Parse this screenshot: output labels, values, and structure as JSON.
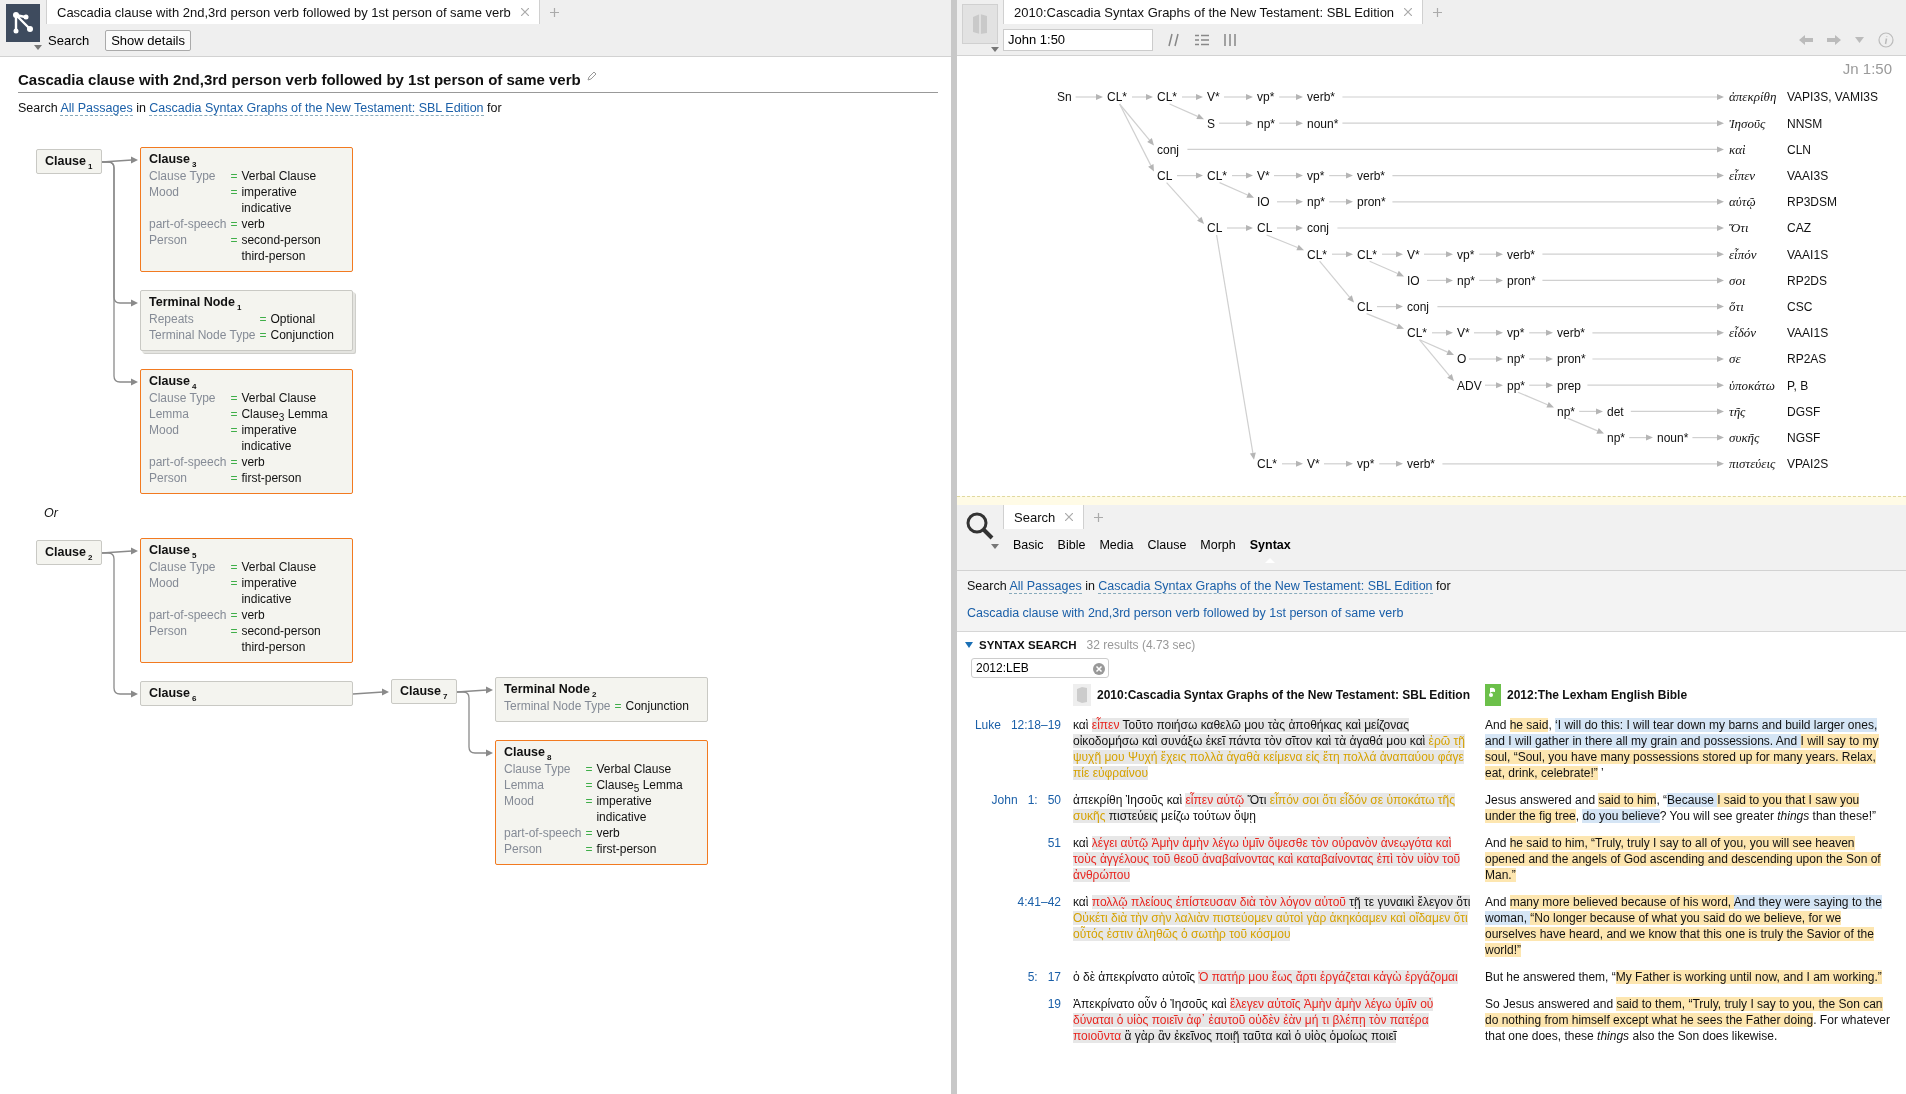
{
  "left_panel": {
    "tab": {
      "title": "Cascadia clause with 2nd,3rd person verb followed by 1st person of same verb"
    },
    "toolbar": {
      "search_label": "Search",
      "details_button": "Show details"
    },
    "heading": "Cascadia clause with 2nd,3rd person verb followed by 1st person of same verb",
    "search_line": {
      "prefix": "Search",
      "range": "All Passages",
      "joiner": "in",
      "resource": "Cascadia Syntax Graphs of the New Testament: SBL Edition",
      "suffix": "for"
    },
    "query": {
      "separator": "Or",
      "alternatives": [
        {
          "title": "Clause",
          "index": "1",
          "highlighted": false,
          "stacked": false,
          "children": [
            {
              "title": "Clause",
              "index": "3",
              "highlighted": true,
              "stacked": false,
              "attributes": [
                {
                  "name": "Clause Type",
                  "operator": "=",
                  "values": [
                    "Verbal Clause"
                  ]
                },
                {
                  "name": "Mood",
                  "operator": "=",
                  "values": [
                    "imperative",
                    "indicative"
                  ]
                },
                {
                  "name": "part-of-speech",
                  "operator": "=",
                  "values": [
                    "verb"
                  ]
                },
                {
                  "name": "Person",
                  "operator": "=",
                  "values": [
                    "second-person",
                    "third-person"
                  ]
                }
              ]
            },
            {
              "title": "Terminal Node",
              "index": "1",
              "highlighted": false,
              "stacked": true,
              "attributes": [
                {
                  "name": "Repeats",
                  "operator": "=",
                  "values": [
                    "Optional"
                  ]
                },
                {
                  "name": "Terminal Node Type",
                  "operator": "=",
                  "values": [
                    "Conjunction"
                  ]
                }
              ]
            },
            {
              "title": "Clause",
              "index": "4",
              "highlighted": true,
              "stacked": false,
              "attributes": [
                {
                  "name": "Clause Type",
                  "operator": "=",
                  "values": [
                    "Verbal Clause"
                  ]
                },
                {
                  "name": "Lemma",
                  "operator": "=",
                  "values": [
                    "Clause$_{3}$ Lemma"
                  ]
                },
                {
                  "name": "Mood",
                  "operator": "=",
                  "values": [
                    "imperative",
                    "indicative"
                  ]
                },
                {
                  "name": "part-of-speech",
                  "operator": "=",
                  "values": [
                    "verb"
                  ]
                },
                {
                  "name": "Person",
                  "operator": "=",
                  "values": [
                    "first-person"
                  ]
                }
              ]
            }
          ]
        },
        {
          "title": "Clause",
          "index": "2",
          "highlighted": false,
          "stacked": false,
          "children": [
            {
              "title": "Clause",
              "index": "5",
              "highlighted": true,
              "stacked": false,
              "attributes": [
                {
                  "name": "Clause Type",
                  "operator": "=",
                  "values": [
                    "Verbal Clause"
                  ]
                },
                {
                  "name": "Mood",
                  "operator": "=",
                  "values": [
                    "imperative",
                    "indicative"
                  ]
                },
                {
                  "name": "part-of-speech",
                  "operator": "=",
                  "values": [
                    "verb"
                  ]
                },
                {
                  "name": "Person",
                  "operator": "=",
                  "values": [
                    "second-person",
                    "third-person"
                  ]
                }
              ]
            },
            {
              "title": "Clause",
              "index": "6",
              "highlighted": false,
              "stacked": false,
              "children": [
                {
                  "title": "Clause",
                  "index": "7",
                  "highlighted": false,
                  "stacked": false,
                  "children": [
                    {
                      "title": "Terminal Node",
                      "index": "2",
                      "highlighted": false,
                      "stacked": false,
                      "attributes": [
                        {
                          "name": "Terminal Node Type",
                          "operator": "=",
                          "values": [
                            "Conjunction"
                          ]
                        }
                      ]
                    },
                    {
                      "title": "Clause",
                      "index": "8",
                      "highlighted": true,
                      "stacked": false,
                      "attributes": [
                        {
                          "name": "Clause Type",
                          "operator": "=",
                          "values": [
                            "Verbal Clause"
                          ]
                        },
                        {
                          "name": "Lemma",
                          "operator": "=",
                          "values": [
                            "Clause$_{5}$ Lemma"
                          ]
                        },
                        {
                          "name": "Mood",
                          "operator": "=",
                          "values": [
                            "imperative",
                            "indicative"
                          ]
                        },
                        {
                          "name": "part-of-speech",
                          "operator": "=",
                          "values": [
                            "verb"
                          ]
                        },
                        {
                          "name": "Person",
                          "operator": "=",
                          "values": [
                            "first-person"
                          ]
                        }
                      ]
                    }
                  ]
                }
              ]
            }
          ]
        }
      ]
    }
  },
  "reader_panel": {
    "tab": {
      "title": "2010:Cascadia Syntax Graphs of the New Testament: SBL Edition"
    },
    "reference_field": {
      "value": "John 1:50"
    },
    "location_label": "Jn 1:50",
    "syntax_tree": {
      "label": "Sn",
      "children": [
        {
          "label": "CL*",
          "children": [
            {
              "label": "CL*",
              "children": [
                {
                  "label": "V*",
                  "children": [
                    {
                      "label": "vp*",
                      "children": [
                        {
                          "label": "verb*",
                          "word": "ἀπεκρίθη",
                          "parse": "VAPI3S, VAMI3S"
                        }
                      ]
                    }
                  ]
                },
                {
                  "label": "S",
                  "children": [
                    {
                      "label": "np*",
                      "children": [
                        {
                          "label": "noun*",
                          "word": "Ἰησοῦς",
                          "parse": "NNSM"
                        }
                      ]
                    }
                  ]
                }
              ]
            },
            {
              "label": "conj",
              "word": "καὶ",
              "parse": "CLN"
            },
            {
              "label": "CL",
              "children": [
                {
                  "label": "CL*",
                  "children": [
                    {
                      "label": "V*",
                      "children": [
                        {
                          "label": "vp*",
                          "children": [
                            {
                              "label": "verb*",
                              "word": "εἶπεν",
                              "parse": "VAAI3S"
                            }
                          ]
                        }
                      ]
                    },
                    {
                      "label": "IO",
                      "children": [
                        {
                          "label": "np*",
                          "children": [
                            {
                              "label": "pron*",
                              "word": "αὐτῷ",
                              "parse": "RP3DSM"
                            }
                          ]
                        }
                      ]
                    }
                  ]
                },
                {
                  "label": "CL",
                  "children": [
                    {
                      "label": "CL",
                      "children": [
                        {
                          "label": "conj",
                          "word": "Ὅτι",
                          "parse": "CAZ"
                        },
                        {
                          "label": "CL*",
                          "children": [
                            {
                              "label": "CL*",
                              "children": [
                                {
                                  "label": "V*",
                                  "children": [
                                    {
                                      "label": "vp*",
                                      "children": [
                                        {
                                          "label": "verb*",
                                          "word": "εἶπόν",
                                          "parse": "VAAI1S"
                                        }
                                      ]
                                    }
                                  ]
                                },
                                {
                                  "label": "IO",
                                  "children": [
                                    {
                                      "label": "np*",
                                      "children": [
                                        {
                                          "label": "pron*",
                                          "word": "σοι",
                                          "parse": "RP2DS"
                                        }
                                      ]
                                    }
                                  ]
                                }
                              ]
                            },
                            {
                              "label": "CL",
                              "children": [
                                {
                                  "label": "conj",
                                  "word": "ὅτι",
                                  "parse": "CSC"
                                },
                                {
                                  "label": "CL*",
                                  "children": [
                                    {
                                      "label": "V*",
                                      "children": [
                                        {
                                          "label": "vp*",
                                          "children": [
                                            {
                                              "label": "verb*",
                                              "word": "εἶδόν",
                                              "parse": "VAAI1S"
                                            }
                                          ]
                                        }
                                      ]
                                    },
                                    {
                                      "label": "O",
                                      "children": [
                                        {
                                          "label": "np*",
                                          "children": [
                                            {
                                              "label": "pron*",
                                              "word": "σε",
                                              "parse": "RP2AS"
                                            }
                                          ]
                                        }
                                      ]
                                    },
                                    {
                                      "label": "ADV",
                                      "children": [
                                        {
                                          "label": "pp*",
                                          "children": [
                                            {
                                              "label": "prep",
                                              "word": "ὑποκάτω",
                                              "parse": "P, B"
                                            },
                                            {
                                              "label": "np*",
                                              "children": [
                                                {
                                                  "label": "det",
                                                  "word": "τῆς",
                                                  "parse": "DGSF"
                                                },
                                                {
                                                  "label": "np*",
                                                  "children": [
                                                    {
                                                      "label": "noun*",
                                                      "word": "συκῆς",
                                                      "parse": "NGSF"
                                                    }
                                                  ]
                                                }
                                              ]
                                            }
                                          ]
                                        }
                                      ]
                                    }
                                  ]
                                }
                              ]
                            }
                          ]
                        }
                      ]
                    },
                    {
                      "label": "CL*",
                      "children": [
                        {
                          "label": "V*",
                          "children": [
                            {
                              "label": "vp*",
                              "children": [
                                {
                                  "label": "verb*",
                                  "word": "πιστεύεις",
                                  "parse": "VPAI2S"
                                }
                              ]
                            }
                          ]
                        }
                      ]
                    }
                  ]
                }
              ]
            }
          ]
        }
      ]
    }
  },
  "search_panel": {
    "tab": {
      "title": "Search"
    },
    "search_types": [
      {
        "label": "Basic",
        "selected": false
      },
      {
        "label": "Bible",
        "selected": false
      },
      {
        "label": "Media",
        "selected": false
      },
      {
        "label": "Clause",
        "selected": false
      },
      {
        "label": "Morph",
        "selected": false
      },
      {
        "label": "Syntax",
        "selected": true
      }
    ],
    "search_line": {
      "prefix": "Search",
      "range": "All Passages",
      "joiner": "in",
      "resource": "Cascadia Syntax Graphs of the New Testament: SBL Edition",
      "suffix": "for"
    },
    "query_link": "Cascadia clause with 2nd,3rd person verb followed by 1st person of same verb",
    "section": {
      "title": "SYNTAX SEARCH",
      "summary": "32 results (4.73 sec)",
      "expanded": true
    },
    "filter_field": {
      "value": "2012:LEB"
    },
    "columns": [
      {
        "title": "2010:Cascadia Syntax Graphs of the New Testament: SBL Edition",
        "kind": "cascadia"
      },
      {
        "title": "2012:The Lexham English Bible",
        "kind": "leb"
      }
    ],
    "results": [
      {
        "reference": [
          "Luke",
          "12:18–19"
        ],
        "greek": [
          {
            "kind": "plain",
            "text": "καὶ "
          },
          {
            "kind": "primary",
            "text": "εἶπεν"
          },
          {
            "kind": "context",
            "text": " Τοῦτο ποιήσω καθελῶ μου τὰς ἀποθήκας καὶ μείζονας οἰκοδομήσω καὶ συνάξω ἐκεῖ πάντα τὸν σῖτον καὶ τὰ ἀγαθά μου καὶ "
          },
          {
            "kind": "secondary",
            "text": "ἐρῶ τῇ ψυχῇ μου Ψυχή ἔχεις πολλὰ ἀγαθὰ κείμενα εἰς ἔτη πολλά ἀναπαύου φάγε πίε εὐφραίνου"
          }
        ],
        "english": [
          {
            "kind": "plain",
            "text": "And "
          },
          {
            "kind": "primary",
            "text": "he said"
          },
          {
            "kind": "plain",
            "text": ", "
          },
          {
            "kind": "secondary",
            "text": "‘I will do this: I will tear down my barns and build larger ones, and I will gather in there all my grain and possessions. And "
          },
          {
            "kind": "primary",
            "text": "I will say to my soul, “Soul, you have many possessions stored up for many years. Relax, eat, drink, celebrate!”"
          },
          {
            "kind": "plain",
            "text": " ’"
          }
        ]
      },
      {
        "reference": [
          "John",
          "1:",
          "50"
        ],
        "greek": [
          {
            "kind": "plain",
            "text": "ἀπεκρίθη Ἰησοῦς καὶ "
          },
          {
            "kind": "primary",
            "text": "εἶπεν αὐτῷ"
          },
          {
            "kind": "context",
            "text": " Ὅτι "
          },
          {
            "kind": "secondary",
            "text": "εἶπόν σοι ὅτι εἶδόν σε ὑποκάτω τῆς συκῆς"
          },
          {
            "kind": "context",
            "text": " πιστεύεις"
          },
          {
            "kind": "plain",
            "text": " μείζω τούτων ὄψῃ"
          }
        ],
        "english": [
          {
            "kind": "plain",
            "text": "Jesus answered and "
          },
          {
            "kind": "primary",
            "text": "said to him"
          },
          {
            "kind": "plain",
            "text": ", “"
          },
          {
            "kind": "secondary",
            "text": "Because "
          },
          {
            "kind": "primary",
            "text": "I said to you that I saw you under the fig tree"
          },
          {
            "kind": "plain",
            "text": ", "
          },
          {
            "kind": "secondary",
            "text": "do you believe"
          },
          {
            "kind": "plain",
            "text": "? You will see greater *things* than these!”"
          }
        ]
      },
      {
        "reference": [
          "51"
        ],
        "greek": [
          {
            "kind": "plain",
            "text": "καὶ "
          },
          {
            "kind": "primary",
            "text": "λέγει αὐτῷ Ἀμὴν ἀμὴν λέγω ὑμῖν ὄψεσθε τὸν οὐρανὸν ἀνεῳγότα καὶ τοὺς ἀγγέλους τοῦ θεοῦ ἀναβαίνοντας καὶ καταβαίνοντας ἐπὶ τὸν υἱὸν τοῦ ἀνθρώπου"
          }
        ],
        "english": [
          {
            "kind": "plain",
            "text": "And "
          },
          {
            "kind": "primary",
            "text": "he said to him, “Truly, truly I say to all of you, you will see heaven opened and the angels of God ascending and descending upon the Son of Man.”"
          }
        ]
      },
      {
        "reference": [
          "4:41–42"
        ],
        "greek": [
          {
            "kind": "plain",
            "text": "καὶ "
          },
          {
            "kind": "primary",
            "text": "πολλῷ πλείους ἐπίστευσαν διὰ τὸν λόγον αὐτοῦ"
          },
          {
            "kind": "context",
            "text": " τῇ τε γυναικὶ ἔλεγον ὅτι "
          },
          {
            "kind": "secondary",
            "text": "Οὐκέτι διὰ τὴν σὴν λαλιὰν πιστεύομεν αὐτοὶ γὰρ ἀκηκόαμεν καὶ οἴδαμεν ὅτι οὗτός ἐστιν ἀληθῶς ὁ σωτὴρ τοῦ κόσμου"
          }
        ],
        "english": [
          {
            "kind": "plain",
            "text": "And "
          },
          {
            "kind": "primary",
            "text": "many more believed because of his word, "
          },
          {
            "kind": "secondary",
            "text": "And they were saying to the woman, "
          },
          {
            "kind": "primary",
            "text": "“No longer because of what you said do we believe, for we ourselves have heard, and we know that this one is truly the Savior of the world!”"
          }
        ]
      },
      {
        "reference": [
          "5:",
          "17"
        ],
        "greek": [
          {
            "kind": "plain",
            "text": "ὁ δὲ ἀπεκρίνατο αὐτοῖς "
          },
          {
            "kind": "primary",
            "text": "Ὁ πατήρ μου ἕως ἄρτι ἐργάζεται κἀγὼ ἐργάζομαι"
          }
        ],
        "english": [
          {
            "kind": "plain",
            "text": "But he answered them, “"
          },
          {
            "kind": "primary",
            "text": "My Father is working until now, and I am working.”"
          }
        ]
      },
      {
        "reference": [
          "19"
        ],
        "greek": [
          {
            "kind": "plain",
            "text": "Ἀπεκρίνατο οὖν ὁ Ἰησοῦς καὶ "
          },
          {
            "kind": "primary",
            "text": "ἔλεγεν αὐτοῖς Ἀμὴν ἀμὴν λέγω ὑμῖν οὐ δύναται ὁ υἱὸς ποιεῖν ἀφ᾽ ἑαυτοῦ οὐδὲν ἐὰν μή τι βλέπῃ τὸν πατέρα ποιοῦντα"
          },
          {
            "kind": "context",
            "text": " ἃ γὰρ ἂν ἐκεῖνος ποιῇ ταῦτα καὶ ὁ υἱὸς ὁμοίως ποιεῖ"
          }
        ],
        "english": [
          {
            "kind": "plain",
            "text": "So Jesus answered and "
          },
          {
            "kind": "primary",
            "text": "said to them, “Truly, truly I say to you, the Son can do nothing from himself except what he sees the Father doing"
          },
          {
            "kind": "plain",
            "text": ". For whatever that one does, these *things* also the Son does likewise."
          }
        ]
      }
    ]
  }
}
